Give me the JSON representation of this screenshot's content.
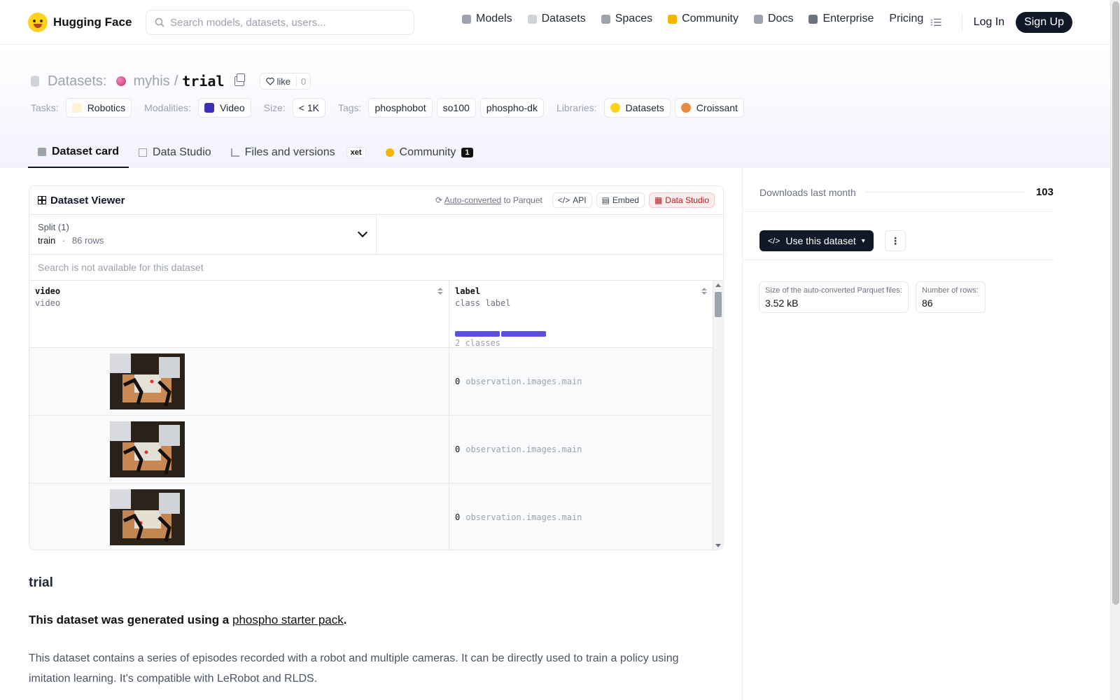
{
  "nav": {
    "brand": "Hugging Face",
    "search_placeholder": "Search models, datasets, users...",
    "items": [
      {
        "label": "Models",
        "icon": "models-icon",
        "color": "#9ca3af"
      },
      {
        "label": "Datasets",
        "icon": "datasets-icon",
        "color": "#cfd3da"
      },
      {
        "label": "Spaces",
        "icon": "spaces-icon",
        "color": "#9ca3af"
      },
      {
        "label": "Community",
        "icon": "community-icon",
        "color": "#f5b400"
      },
      {
        "label": "Docs",
        "icon": "docs-icon",
        "color": "#9ca3af"
      },
      {
        "label": "Enterprise",
        "icon": "enterprise-icon",
        "color": "#6b7280"
      },
      {
        "label": "Pricing",
        "icon": "",
        "color": ""
      }
    ],
    "login": "Log In",
    "signup": "Sign Up"
  },
  "repo": {
    "type_label": "Datasets:",
    "owner": "myhis",
    "separator": "/",
    "name": "trial",
    "like_label": "like",
    "like_count": "0"
  },
  "tags": {
    "tasks_label": "Tasks:",
    "tasks": [
      "Robotics"
    ],
    "modalities_label": "Modalities:",
    "modalities": [
      "Video"
    ],
    "size_label": "Size:",
    "size": [
      "< 1K"
    ],
    "tags_label": "Tags:",
    "tags": [
      "phosphobot",
      "so100",
      "phospho-dk"
    ],
    "libraries_label": "Libraries:",
    "libraries": [
      "Datasets",
      "Croissant"
    ]
  },
  "tabs": {
    "dataset_card": "Dataset card",
    "data_studio": "Data Studio",
    "files": "Files and versions",
    "xet": "xet",
    "community": "Community",
    "community_count": "1"
  },
  "viewer": {
    "title": "Dataset Viewer",
    "auto_converted": "Auto-converted",
    "to_parquet": "to Parquet",
    "api": "API",
    "embed": "Embed",
    "data_studio": "Data Studio",
    "split_title": "Split (1)",
    "split_value": "train",
    "split_dot": "·",
    "split_rows": "86 rows",
    "search_msg": "Search is not available for this dataset",
    "columns": [
      {
        "name": "video",
        "type": "video"
      },
      {
        "name": "label",
        "type": "class label",
        "classes": "2 classes"
      }
    ],
    "class_bar_fractions": [
      0.5,
      0.5
    ],
    "rows": [
      {
        "label_id": "0",
        "label_name": "observation.images.main"
      },
      {
        "label_id": "0",
        "label_name": "observation.images.main"
      },
      {
        "label_id": "0",
        "label_name": "observation.images.main"
      }
    ]
  },
  "card": {
    "heading": "trial",
    "p1_before": "This dataset was generated using a ",
    "p1_link": "phospho starter pack",
    "p1_after": ".",
    "p2": "This dataset contains a series of episodes recorded with a robot and multiple cameras. It can be directly used to train a policy using imitation learning. It's compatible with LeRobot and RLDS."
  },
  "sidebar": {
    "downloads_label": "Downloads last month",
    "downloads_value": "103",
    "use_dataset": "Use this dataset",
    "parquet_size_label": "Size of the auto-converted Parquet files:",
    "parquet_size_value": "3.52 kB",
    "rows_label": "Number of rows:",
    "rows_value": "86"
  }
}
